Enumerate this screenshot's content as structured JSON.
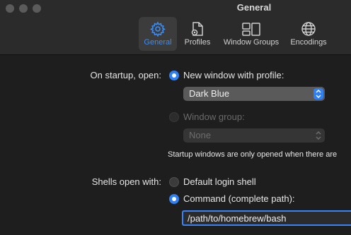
{
  "window": {
    "title": "General"
  },
  "toolbar": {
    "tabs": [
      {
        "label": "General",
        "icon": "gear-icon"
      },
      {
        "label": "Profiles",
        "icon": "profiles-icon"
      },
      {
        "label": "Window Groups",
        "icon": "window-groups-icon"
      },
      {
        "label": "Encodings",
        "icon": "globe-icon"
      }
    ],
    "accent": "#3b8cf5"
  },
  "startup": {
    "label": "On startup, open:",
    "option_profile": "New window with profile:",
    "profile_value": "Dark Blue",
    "option_group": "Window group:",
    "group_value": "None",
    "note": "Startup windows are only opened when there are"
  },
  "shells": {
    "label": "Shells open with:",
    "option_default": "Default login shell",
    "option_command": "Command (complete path):",
    "command_value": "/path/to/homebrew/bash"
  }
}
